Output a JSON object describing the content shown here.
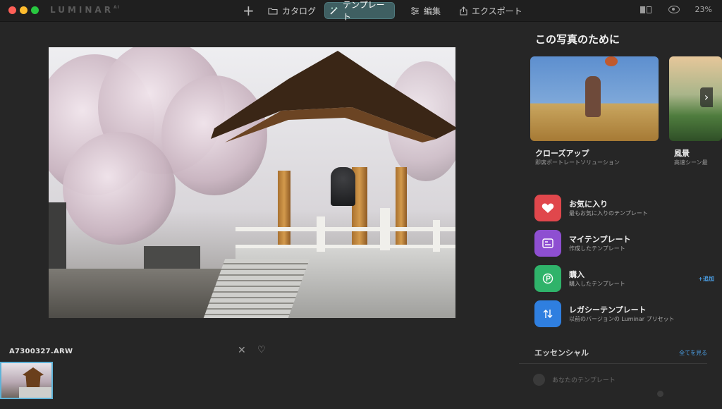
{
  "app": {
    "logo": "LUMINAR",
    "logo_sup": "AI"
  },
  "toolbar": {
    "add_icon": "plus-icon",
    "nav": [
      {
        "label": "カタログ",
        "icon": "folder-icon"
      },
      {
        "label": "テンプレート",
        "icon": "magic-wand-icon",
        "active": true
      },
      {
        "label": "編集",
        "icon": "sliders-icon"
      },
      {
        "label": "エクスポート",
        "icon": "share-icon"
      }
    ],
    "zoom": "23%"
  },
  "viewer": {
    "filename": "A7300327.ARW"
  },
  "panel": {
    "title": "この写真のために",
    "cards": [
      {
        "name": "クローズアップ",
        "subtitle": "即席ポートレートソリューション"
      },
      {
        "name": "風景",
        "subtitle": "高速シーン最"
      }
    ],
    "items": [
      {
        "title": "お気に入り",
        "subtitle": "最もお気に入りのテンプレート",
        "color": "#e0474c"
      },
      {
        "title": "マイテンプレート",
        "subtitle": "作成したテンプレート",
        "color": "#8e4fd1"
      },
      {
        "title": "購入",
        "subtitle": "購入したテンプレート",
        "color": "#2fb36a",
        "action": "+追加"
      },
      {
        "title": "レガシーテンプレート",
        "subtitle": "以前のバージョンの Luminar プリセット",
        "color": "#2f7fe0"
      }
    ],
    "section": {
      "title": "エッセンシャル",
      "link": "全てを見る"
    },
    "your_templates": "あなたのテンプレート"
  },
  "colors": {
    "accent": "#4b9fe5",
    "active_tab": "#3f5f62",
    "selection": "#5fb3d8"
  }
}
